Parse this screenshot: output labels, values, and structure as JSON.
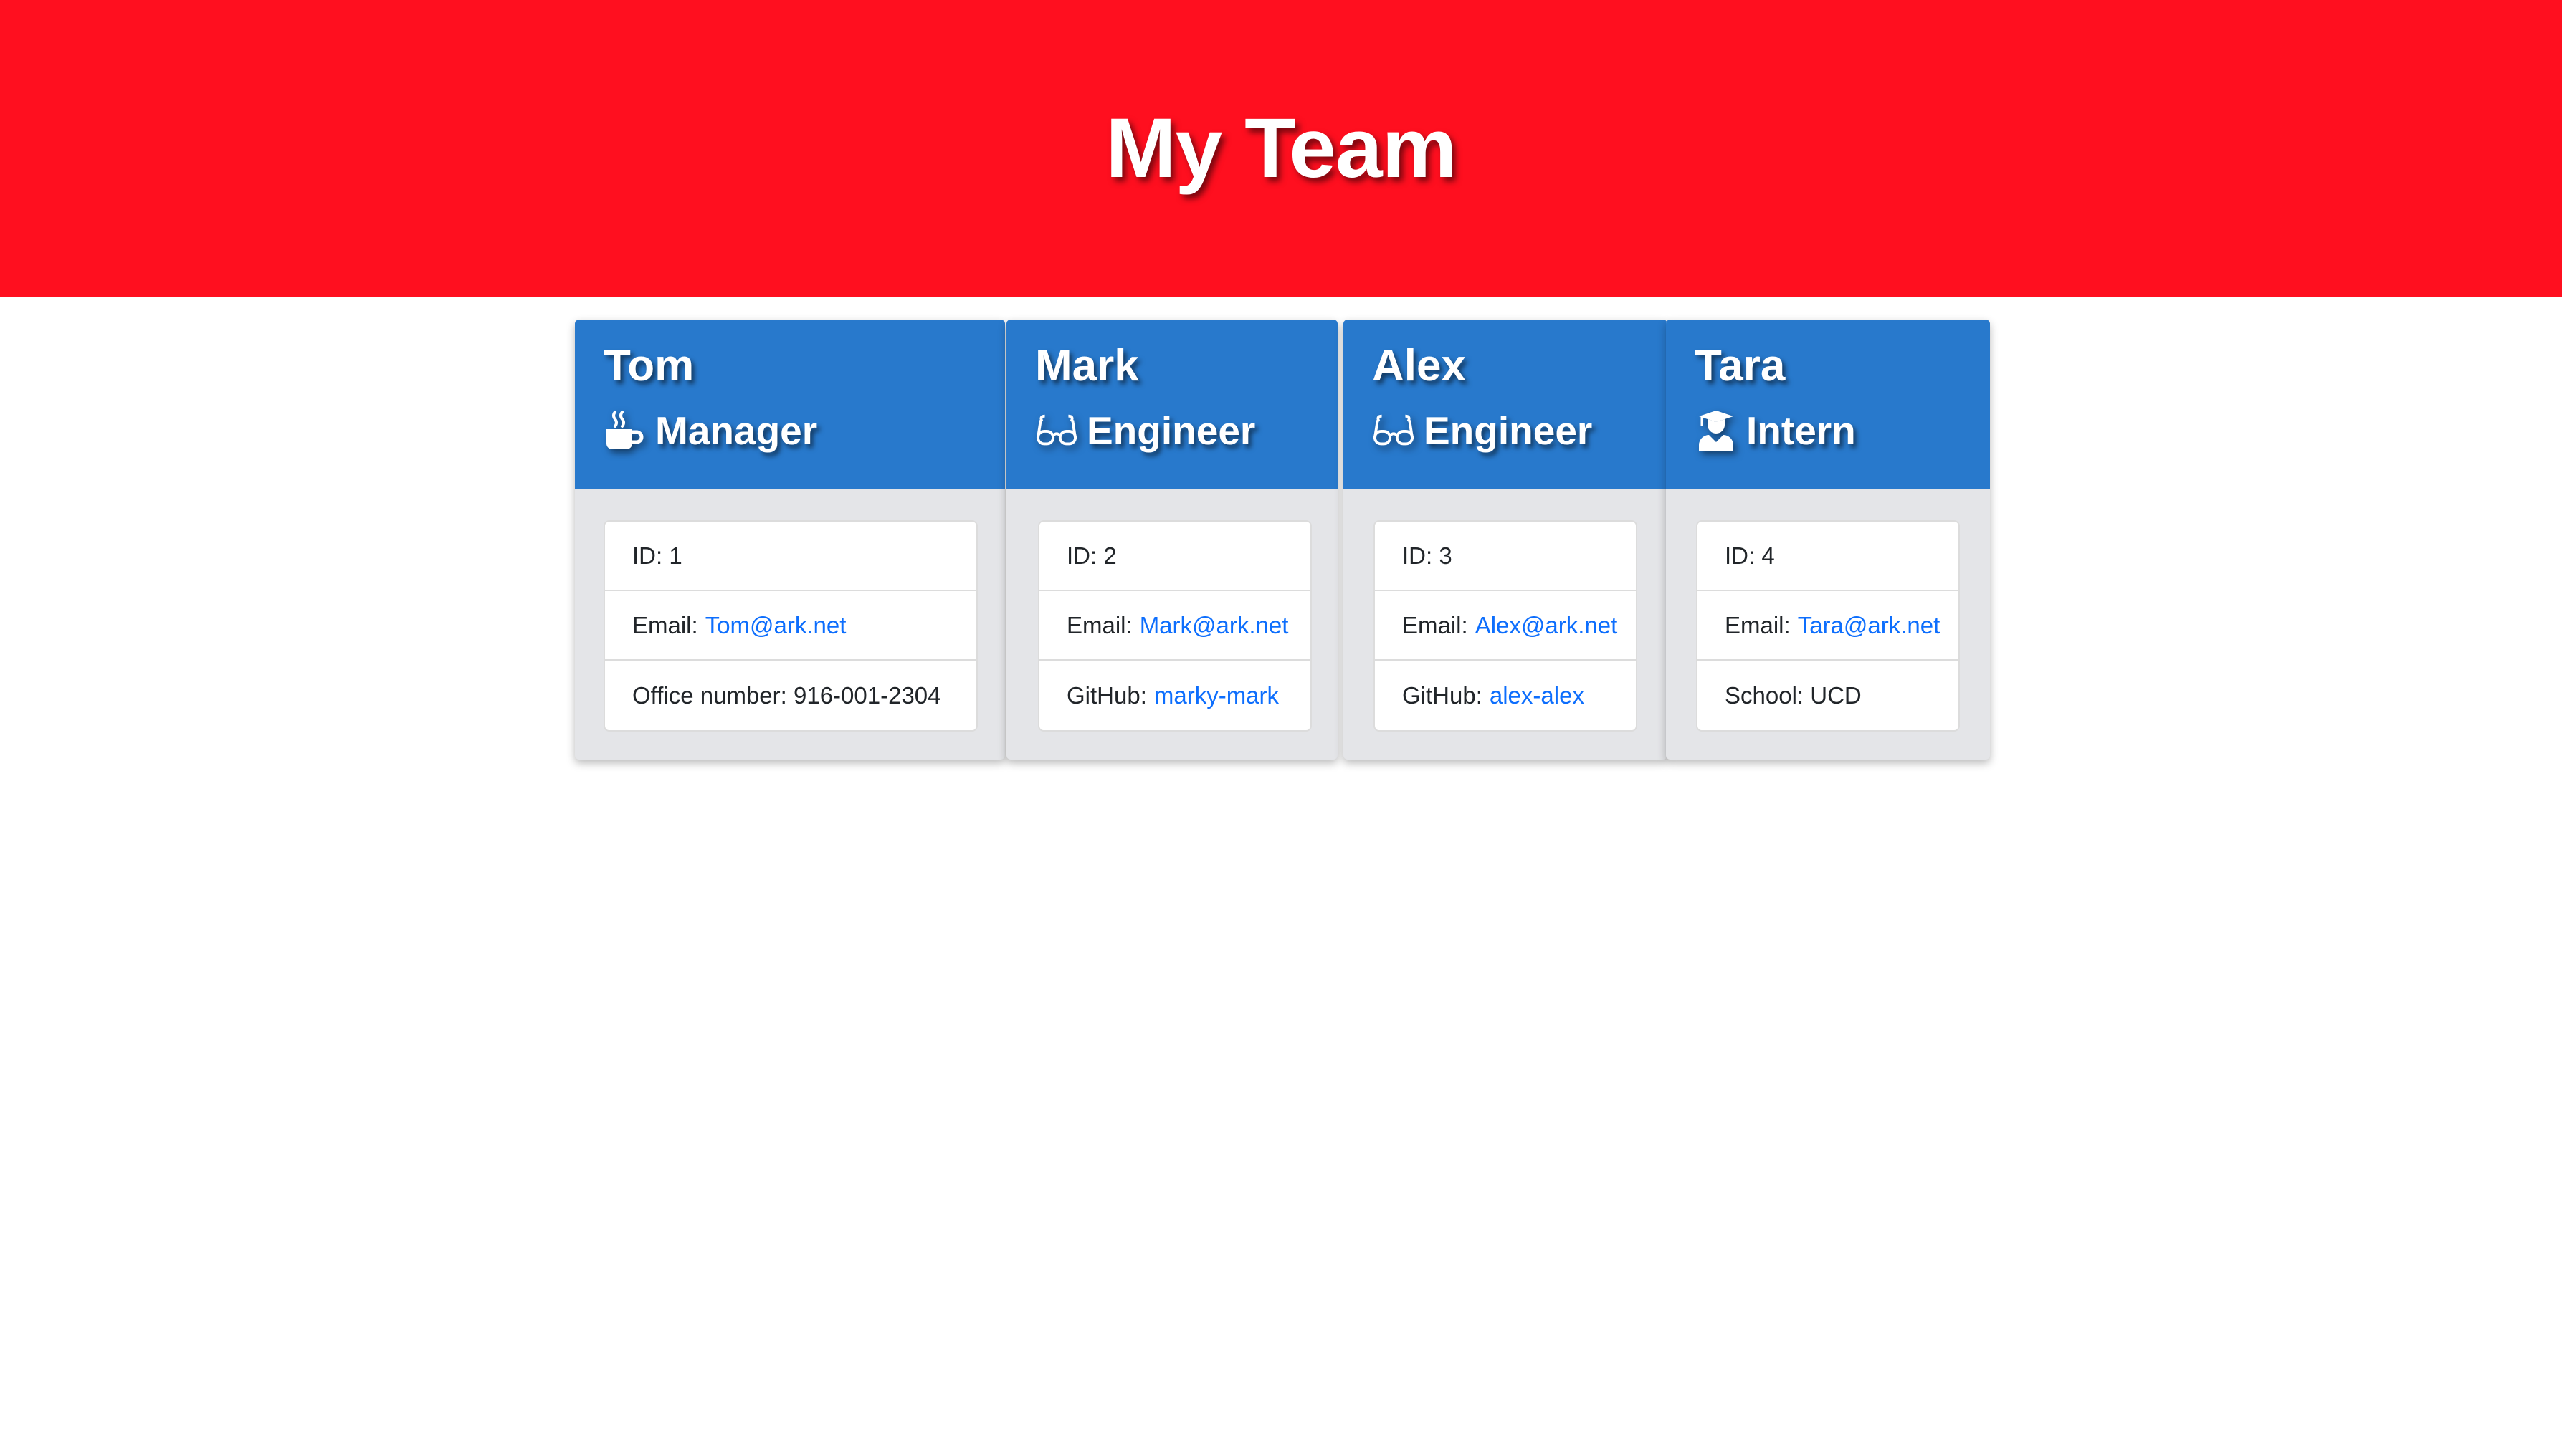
{
  "page": {
    "title": "My Team"
  },
  "colors": {
    "header_bg": "#ff0f1f",
    "card_header_bg": "#2879cc",
    "card_body_bg": "#e4e5e8",
    "link": "#0d6efd"
  },
  "team": [
    {
      "name": "Tom",
      "role": "Manager",
      "role_icon": "mug-icon",
      "id_text": "ID: 1",
      "email_label": "Email:",
      "email": "Tom@ark.net",
      "extra_label": "Office number: 916-001-2304",
      "extra_value": ""
    },
    {
      "name": "Mark",
      "role": "Engineer",
      "role_icon": "glasses-icon",
      "id_text": "ID: 2",
      "email_label": "Email:",
      "email": "Mark@ark.net",
      "extra_label": "GitHub:",
      "extra_value": "marky-mark"
    },
    {
      "name": "Alex",
      "role": "Engineer",
      "role_icon": "glasses-icon",
      "id_text": "ID: 3",
      "email_label": "Email:",
      "email": "Alex@ark.net",
      "extra_label": "GitHub:",
      "extra_value": "alex-alex"
    },
    {
      "name": "Tara",
      "role": "Intern",
      "role_icon": "graduate-icon",
      "id_text": "ID: 4",
      "email_label": "Email:",
      "email": "Tara@ark.net",
      "extra_label": "School: UCD",
      "extra_value": ""
    }
  ]
}
